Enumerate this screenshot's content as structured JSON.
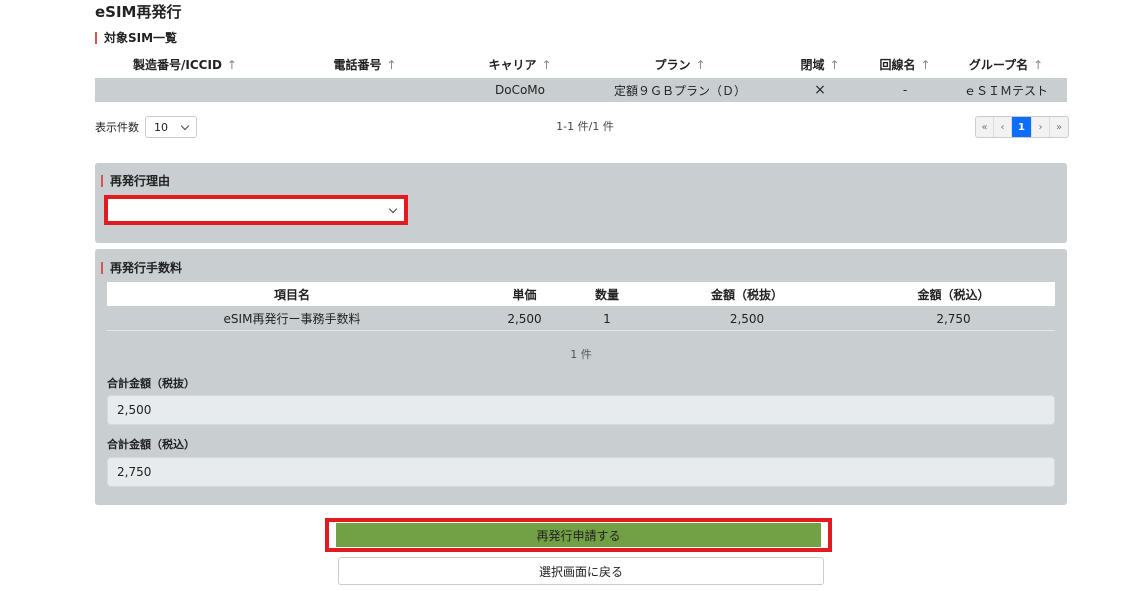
{
  "page_title": "eSIM再発行",
  "sim_list": {
    "label": "対象SIM一覧",
    "sort_icon": "arrow-up-icon",
    "columns": [
      "製造番号/ICCID",
      "電話番号",
      "キャリア",
      "プラン",
      "閉域",
      "回線名",
      "グループ名"
    ],
    "rows": [
      [
        "",
        "",
        "DoCoMo",
        "定額９ＧＢプラン（Ｄ）",
        "×",
        "-",
        "ｅＳＩＭテスト"
      ]
    ],
    "per_page_label": "表示件数",
    "per_page_value": "10",
    "range_text": "1-1 件/1 件",
    "pager": {
      "first": "«",
      "prev": "‹",
      "current": "1",
      "next": "›",
      "last": "»"
    }
  },
  "reason": {
    "label": "再発行理由",
    "selected": ""
  },
  "fee": {
    "label": "再発行手数料",
    "columns": [
      "項目名",
      "単価",
      "数量",
      "金額（税抜）",
      "金額（税込）"
    ],
    "rows": [
      [
        "eSIM再発行ー事務手数料",
        "2,500",
        "1",
        "2,500",
        "2,750"
      ]
    ],
    "count_text": "1 件",
    "total_ex_label": "合計金額（税抜）",
    "total_ex_value": "2,500",
    "total_in_label": "合計金額（税込）",
    "total_in_value": "2,750"
  },
  "buttons": {
    "submit": "再発行申請する",
    "back": "選択画面に戻る"
  },
  "colors": {
    "panel": "#c9cfd1",
    "highlight": "#e21b22",
    "submit": "#71a045",
    "pager_active": "#0d6efd"
  }
}
